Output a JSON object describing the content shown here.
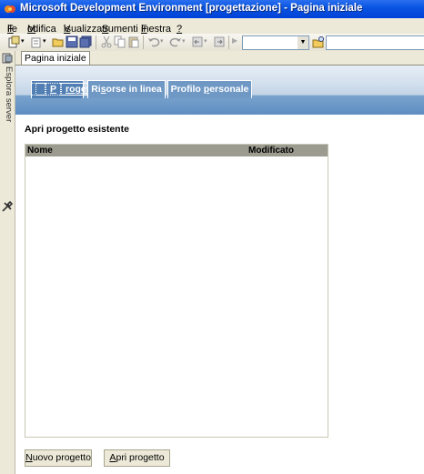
{
  "window": {
    "title": "Microsoft Development Environment [progettazione] - Pagina iniziale"
  },
  "menu": {
    "items": [
      {
        "pre": "",
        "u": "F",
        "post": "ile"
      },
      {
        "pre": "",
        "u": "M",
        "post": "odifica"
      },
      {
        "pre": "",
        "u": "V",
        "post": "isualizza"
      },
      {
        "pre": "",
        "u": "S",
        "post": "trumenti"
      },
      {
        "pre": "",
        "u": "F",
        "post": "inestra"
      },
      {
        "pre": "",
        "u": "?",
        "post": ""
      }
    ]
  },
  "left_panel": {
    "server_explorer": "Esplora server"
  },
  "doc_tab": {
    "label": "Pagina iniziale"
  },
  "start_page": {
    "tabs": [
      {
        "pre": "",
        "u": "P",
        "post": "rogetti"
      },
      {
        "pre": "Ri",
        "u": "s",
        "post": "orse in linea"
      },
      {
        "pre": "Profilo ",
        "u": "p",
        "post": "ersonale"
      }
    ],
    "section_title": "Apri progetto esistente",
    "columns": {
      "name": "Nome",
      "modified": "Modificato"
    },
    "buttons": {
      "new_project": {
        "pre": "",
        "u": "N",
        "post": "uovo progetto"
      },
      "open_project": {
        "pre": "",
        "u": "A",
        "post": "pri progetto"
      }
    }
  },
  "colors": {
    "titlebar": "#0a55e2",
    "banner_dark": "#5d8ec2",
    "grid_header": "#9c9b8f"
  }
}
